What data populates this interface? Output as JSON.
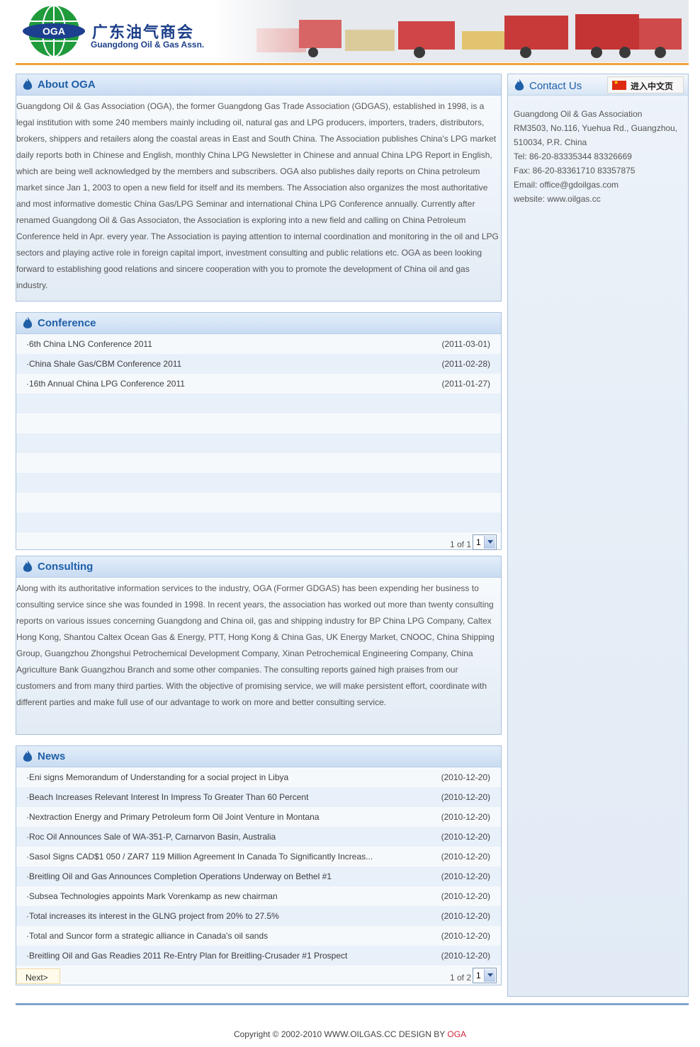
{
  "header": {
    "logo_badge": "OGA",
    "logo_cn": "广东油气商会",
    "logo_en": "Guangdong Oil & Gas Assn."
  },
  "about": {
    "title": "About OGA",
    "body": "Guangdong Oil & Gas Association (OGA), the former Guangdong Gas Trade Association (GDGAS), established in 1998, is a legal institution with some 240 members mainly including oil, natural gas and LPG producers, importers, traders, distributors, brokers, shippers and retailers along the coastal areas in East and South China. The Association publishes China's LPG market daily reports both in Chinese and English, monthly China LPG Newsletter in Chinese and annual China LPG Report in English, which are being well acknowledged by the members and subscribers. OGA also publishes daily reports on China petroleum market since Jan 1, 2003 to open a new field for itself and its members. The Association also organizes the most authoritative and most informative domestic China Gas/LPG Seminar and international China LPG Conference annually. Currently after renamed Guangdong Oil & Gas Associaton, the Association is exploring into a new field and calling on China Petroleum Conference held in Apr. every year. The Association is paying attention to internal coordination and monitoring in the oil and LPG sectors and playing active role in foreign capital import, investment consulting and public relations etc. OGA as been looking forward to establishing good relations and sincere cooperation with you to promote the development of China oil and gas industry."
  },
  "conference": {
    "title": "Conference",
    "items": [
      {
        "title": "·6th China LNG Conference 2011",
        "date": "(2011-03-01)"
      },
      {
        "title": "·China Shale Gas/CBM Conference 2011",
        "date": "(2011-02-28)"
      },
      {
        "title": "·16th Annual China LPG Conference 2011",
        "date": "(2011-01-27)"
      }
    ],
    "page_info": "1 of 1",
    "page_value": "1"
  },
  "consulting": {
    "title": "Consulting",
    "body": "Along with its authoritative information services to the industry, OGA (Former GDGAS) has been expending her business to consulting service since she was founded in 1998. In recent years, the association has worked out more than twenty consulting reports on various issues concerning Guangdong and China oil, gas and shipping industry for BP China LPG Company, Caltex Hong Kong, Shantou Caltex Ocean Gas & Energy, PTT, Hong Kong & China Gas, UK Energy Market, CNOOC, China Shipping Group, Guangzhou Zhongshui Petrochemical Development Company, Xinan Petrochemical Engineering Company, China Agriculture Bank Guangzhou Branch and some other companies. The consulting reports gained high praises from our customers and from many third parties. With the objective of promising service, we will make persistent effort, coordinate with different parties and make full use of our advantage to work on more and better consulting service."
  },
  "news": {
    "title": "News",
    "items": [
      {
        "title": "·Eni signs Memorandum of Understanding for a social project in Libya",
        "date": "(2010-12-20)"
      },
      {
        "title": "·Beach Increases Relevant Interest In Impress To Greater Than 60 Percent",
        "date": "(2010-12-20)"
      },
      {
        "title": "·Nextraction Energy and Primary Petroleum form Oil Joint Venture in Montana",
        "date": "(2010-12-20)"
      },
      {
        "title": "·Roc Oil Announces Sale of WA-351-P, Carnarvon Basin, Australia",
        "date": "(2010-12-20)"
      },
      {
        "title": "·Sasol Signs CAD$1 050 / ZAR7 119 Million Agreement In Canada To Significantly Increas...",
        "date": "(2010-12-20)"
      },
      {
        "title": "·Breitling Oil and Gas Announces Completion Operations Underway on Bethel #1",
        "date": "(2010-12-20)"
      },
      {
        "title": "·Subsea Technologies appoints Mark Vorenkamp as new chairman",
        "date": "(2010-12-20)"
      },
      {
        "title": "·Total increases its interest in the GLNG project from 20% to 27.5%",
        "date": "(2010-12-20)"
      },
      {
        "title": "·Total and Suncor form a strategic alliance in Canada's oil sands",
        "date": "(2010-12-20)"
      },
      {
        "title": "·Breitling Oil and Gas Readies 2011 Re-Entry Plan for Breitling-Crusader #1 Prospect",
        "date": "(2010-12-20)"
      }
    ],
    "next_label": "Next>",
    "page_info": "1 of 2",
    "page_value": "1"
  },
  "contact": {
    "title": "Contact Us",
    "cn_link": "进入中文页",
    "lines": [
      "Guangdong Oil & Gas Association",
      "RM3503, No.116, Yuehua Rd., Guangzhou,",
      "510034, P.R. China",
      "Tel: 86-20-83335344 83326669",
      "Fax: 86-20-83361710 83357875",
      "Email: office@gdoilgas.com",
      "website: www.oilgas.cc"
    ]
  },
  "footer": {
    "copyright": "Copyright © 2002-2010  WWW.OILGAS.CC DESIGN BY ",
    "brand": "OGA"
  },
  "colors": {
    "accent_orange": "#f0a23b",
    "title_blue": "#1f5fa8",
    "row_alt": "#e8f0f9",
    "footer_brand": "#d0263d"
  }
}
